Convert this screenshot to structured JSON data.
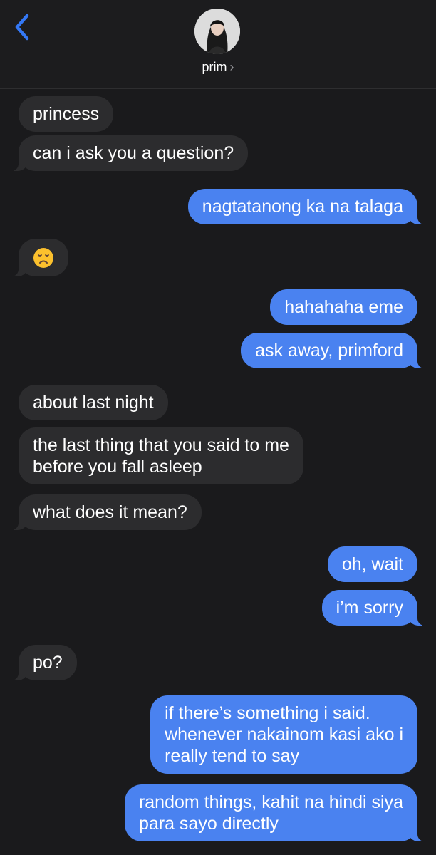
{
  "header": {
    "contact_name": "prim",
    "chevron": "›",
    "back_icon": "chevron-left-icon",
    "accent_color": "#3478f6"
  },
  "messages": [
    {
      "from": "them",
      "text": "princess"
    },
    {
      "from": "them",
      "text": "can i ask you a question?"
    },
    {
      "from": "me",
      "text": "nagtatanong ka na talaga"
    },
    {
      "from": "them",
      "text": "😞",
      "emoji_name": "disappointed-face"
    },
    {
      "from": "me",
      "text": "hahahaha eme"
    },
    {
      "from": "me",
      "text": "ask away, primford"
    },
    {
      "from": "them",
      "text": "about last night"
    },
    {
      "from": "them",
      "lines": [
        "the last thing that you said to me",
        "before you fall asleep"
      ]
    },
    {
      "from": "them",
      "text": "what does it mean?"
    },
    {
      "from": "me",
      "text": "oh, wait"
    },
    {
      "from": "me",
      "text": "i’m sorry"
    },
    {
      "from": "them",
      "text": "po?"
    },
    {
      "from": "me",
      "lines": [
        "if there’s something i said.",
        "whenever nakainom kasi ako i",
        "really tend to say"
      ]
    },
    {
      "from": "me",
      "lines": [
        "random things, kahit na hindi siya",
        "para sayo directly"
      ]
    }
  ],
  "colors": {
    "sent_bubble": "#4a82f0",
    "received_bubble": "#2c2c2e",
    "background": "#1a1a1c"
  }
}
